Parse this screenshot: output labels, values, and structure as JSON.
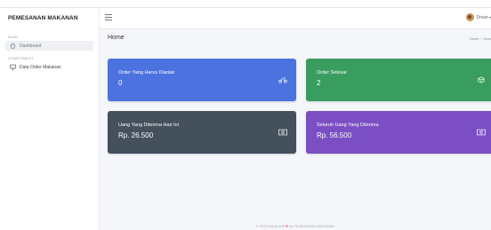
{
  "brand": "PEMESANAN MAKANAN",
  "sidebar": {
    "sections": [
      {
        "label": "MAIN",
        "items": [
          {
            "label": "Dashboard",
            "active": true
          }
        ]
      },
      {
        "label": "COMPONENT",
        "items": [
          {
            "label": "Data Order Makanan",
            "active": false
          }
        ]
      }
    ]
  },
  "topbar": {
    "user_label": "Driver",
    "user_chevron": "▾"
  },
  "page": {
    "title": "Home",
    "breadcrumb": [
      "Home",
      "Hom"
    ],
    "breadcrumb_sep": "/"
  },
  "cards": [
    {
      "label": "Order Yang Harus Diantar",
      "value": "0",
      "icon": "motorcycle-icon",
      "color": "#4b72de"
    },
    {
      "label": "Order Selesai",
      "value": "2",
      "icon": "box-icon",
      "color": "#3a9d60"
    },
    {
      "label": "Uang Yang Diterima Hari Ini",
      "value": "Rp. 26.500",
      "icon": "money-icon",
      "color": "#44505c"
    },
    {
      "label": "Seluruh Uang Yang Diterima",
      "value": "Rp. 56.500",
      "icon": "money-icon",
      "color": "#7b4fc3"
    }
  ],
  "footer": {
    "prefix": "© 2023 Made with",
    "heart": "♥",
    "suffix": "by PEMESANAN MAKANAN"
  }
}
